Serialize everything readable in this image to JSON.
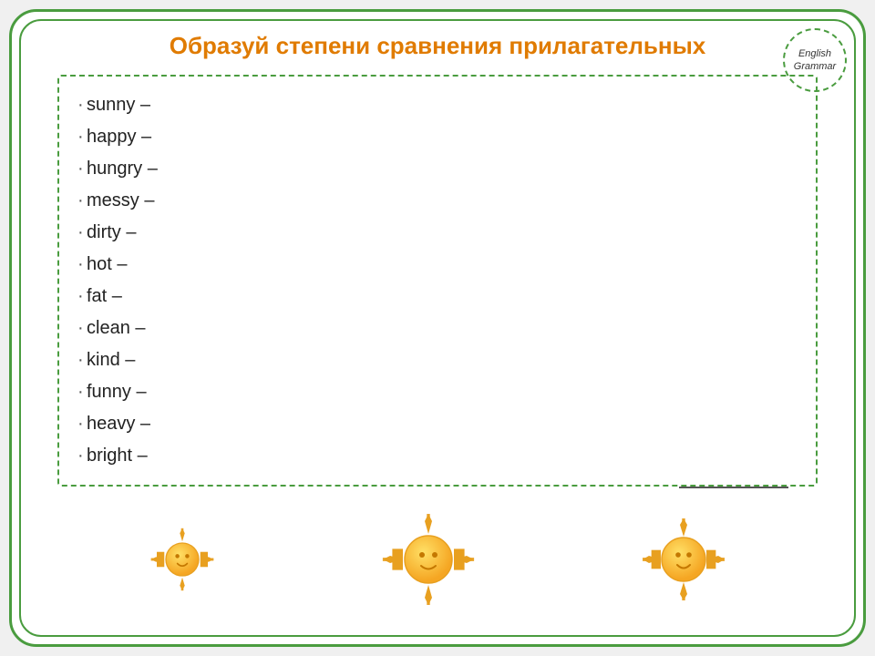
{
  "title": "Образуй степени сравнения прилагательных",
  "badge": {
    "line1": "English",
    "line2": "Grammar"
  },
  "words": [
    "sunny –",
    "happy –",
    "hungry –",
    "messy –",
    "dirty –",
    "hot –",
    "fat –",
    "clean –",
    "kind –",
    "funny –",
    "heavy –",
    "bright –"
  ],
  "suns": [
    {
      "size": "small",
      "label": "sun-left"
    },
    {
      "size": "medium",
      "label": "sun-center"
    },
    {
      "size": "large",
      "label": "sun-right"
    }
  ]
}
